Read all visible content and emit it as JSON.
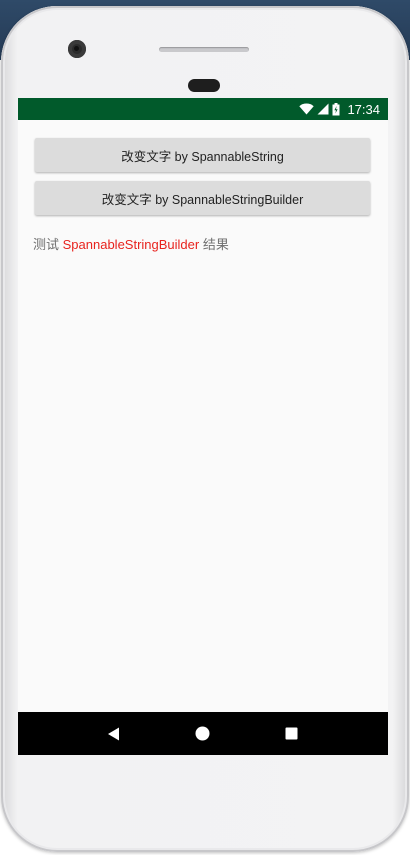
{
  "status_bar": {
    "time": "17:34",
    "background": "#015a2b",
    "icons": [
      "wifi-icon",
      "signal-icon",
      "battery-icon"
    ]
  },
  "buttons": [
    {
      "label": "改变文字 by SpannableString"
    },
    {
      "label": "改变文字 by SpannableStringBuilder"
    }
  ],
  "result_text": {
    "prefix": "测试 ",
    "highlight": "SpannableStringBuilder",
    "suffix": " 结果",
    "highlight_color": "#e8231e"
  },
  "nav_bar": {
    "icons": [
      "back-icon",
      "home-icon",
      "recents-icon"
    ]
  }
}
